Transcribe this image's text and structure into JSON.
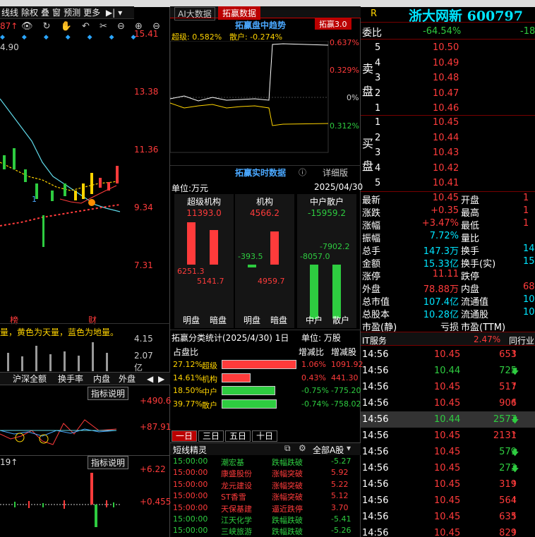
{
  "left": {
    "toolbar1": [
      "线线",
      "除权",
      "叠",
      "窗",
      "预测",
      "更多"
    ],
    "price_badge": "87↑",
    "price_value": "4.90",
    "axis_labels": [
      "15.41",
      "13.38",
      "11.36",
      "9.34",
      "7.31"
    ],
    "date_marks": [
      "榜",
      "财"
    ],
    "vol_legend": "量，黄色为天量，蓝色为地量。",
    "vol_axis": [
      "4.15",
      "2.07",
      "亿"
    ],
    "tabs2": [
      "沪深全额",
      "换手率",
      "内盘",
      "外盘"
    ],
    "ind_btn1": "指标说明",
    "ind_axis1": [
      "+490.6",
      "+87.91"
    ],
    "ind_val2": "19↑",
    "ind_btn2": "指标说明",
    "ind_axis2": [
      "+6.22",
      "+0.455"
    ]
  },
  "mid": {
    "tabs": [
      "AI大数据",
      "拓赢数据"
    ],
    "chart_title": "拓赢盘中趋势",
    "chart_badge": "拓赢3.0",
    "chart_legend_super": "超级: 0.582%",
    "chart_legend_retail": "散户: -0.274%",
    "chart_axis": [
      "0.637%",
      "0.329%",
      "0%",
      "0.312%"
    ],
    "realtime_title": "拓赢实时数据",
    "detail": "详细版",
    "unit": "单位:万元",
    "date": "2025/04/30",
    "cols": [
      {
        "name": "超级机构",
        "total": "11393.0",
        "v1": "6251.3",
        "v2": "5141.7",
        "l1": "明盘",
        "l2": "暗盘"
      },
      {
        "name": "机构",
        "total": "4566.2",
        "v1": "-393.5",
        "v2": "4959.7",
        "l1": "明盘",
        "l2": "暗盘"
      },
      {
        "name": "中户散户",
        "total": "-15959.2",
        "v1": "-8057.0",
        "v2": "-7902.2",
        "l1": "中户",
        "l2": "散户"
      }
    ],
    "cls_title": "拓赢分类统计(2025/4/30) 1日",
    "cls_unit": "单位: 万股",
    "cls_header": [
      "占盘比",
      "增减比",
      "增减股"
    ],
    "cls_rows": [
      {
        "pct": "27.12%",
        "name": "超级",
        "chg": "1.06%",
        "shares": "1091.92",
        "bar": 1.0,
        "color": "#ff3b3b"
      },
      {
        "pct": "14.61%",
        "name": "机构",
        "chg": "0.43%",
        "shares": "441.30",
        "bar": 0.39,
        "color": "#ff3b3b"
      },
      {
        "pct": "18.50%",
        "name": "中户",
        "chg": "-0.75%",
        "shares": "-775.20",
        "bar": 0.72,
        "color": "#2ecc40"
      },
      {
        "pct": "39.77%",
        "name": "散户",
        "chg": "-0.74%",
        "shares": "-758.02",
        "bar": 0.74,
        "color": "#2ecc40"
      }
    ],
    "period_tabs": [
      "一日",
      "三日",
      "五日",
      "十日"
    ],
    "dx_title": "短线精灵",
    "dx_filter": "全部A股",
    "dx_rows": [
      {
        "time": "15:00:00",
        "name": "潮宏基",
        "type": "跌幅跌破",
        "val": "-5.27"
      },
      {
        "time": "15:00:00",
        "name": "康盛股份",
        "type": "涨幅突破",
        "val": "5.92"
      },
      {
        "time": "15:00:00",
        "name": "龙元建设",
        "type": "涨幅突破",
        "val": "5.22"
      },
      {
        "time": "15:00:00",
        "name": "ST香雪",
        "type": "涨幅突破",
        "val": "5.12"
      },
      {
        "time": "15:00:00",
        "name": "天保基建",
        "type": "逼近跌停",
        "val": "3.70"
      },
      {
        "time": "15:00:00",
        "name": "江天化学",
        "type": "跌幅跌破",
        "val": "-5.41"
      },
      {
        "time": "15:00:00",
        "name": "三峡旅游",
        "type": "跌幅跌破",
        "val": "-5.26"
      }
    ]
  },
  "right": {
    "r": "R",
    "title": "浙大网新 600797",
    "wb_label": "委比",
    "wb_val": "-64.54%",
    "wb_val2": "-18",
    "sell_label": [
      "卖",
      "盘"
    ],
    "buy_label": [
      "买",
      "盘"
    ],
    "sells": [
      {
        "n": "5",
        "p": "10.50"
      },
      {
        "n": "4",
        "p": "10.49"
      },
      {
        "n": "3",
        "p": "10.48"
      },
      {
        "n": "2",
        "p": "10.47"
      },
      {
        "n": "1",
        "p": "10.46"
      }
    ],
    "buys": [
      {
        "n": "1",
        "p": "10.45"
      },
      {
        "n": "2",
        "p": "10.44"
      },
      {
        "n": "3",
        "p": "10.43"
      },
      {
        "n": "4",
        "p": "10.42"
      },
      {
        "n": "5",
        "p": "10.41"
      }
    ],
    "quote": [
      {
        "k": "最新",
        "v": "10.45",
        "k2": "开盘",
        "c": "red"
      },
      {
        "k": "涨跌",
        "v": "+0.35",
        "k2": "最高",
        "c": "red"
      },
      {
        "k": "涨幅",
        "v": "+3.47%",
        "k2": "最低",
        "c": "red"
      },
      {
        "k": "振幅",
        "v": "7.72%",
        "k2": "量比",
        "c": "cyan"
      },
      {
        "k": "总手",
        "v": "147.3万",
        "k2": "换手",
        "c": "cyan"
      },
      {
        "k": "金额",
        "v": "15.33亿",
        "k2": "换手(实)",
        "c": "cyan"
      },
      {
        "k": "涨停",
        "v": "11.11",
        "k2": "跌停",
        "c": "red"
      },
      {
        "k": "外盘",
        "v": "78.88万",
        "k2": "内盘",
        "c": "red"
      },
      {
        "k": "总市值",
        "v": "107.4亿",
        "k2": "流通值",
        "c": "cyan"
      },
      {
        "k": "总股本",
        "v": "10.28亿",
        "k2": "流通股",
        "c": "cyan"
      },
      {
        "k": "市盈(静)",
        "v": "亏损",
        "k2": "市盈(TTM)",
        "c": "wht"
      }
    ],
    "quote_right": [
      "1",
      "1",
      "1",
      "",
      "14",
      "15",
      "",
      "68.",
      "107",
      "10.",
      ""
    ],
    "it_label": "IT服务",
    "it_pct": "2.47%",
    "it_more": "同行业",
    "ticks": [
      {
        "t": "14:56",
        "p": "10.45",
        "v": "653",
        "d": "up"
      },
      {
        "t": "14:56",
        "p": "10.44",
        "v": "725",
        "d": "down"
      },
      {
        "t": "14:56",
        "p": "10.45",
        "v": "517",
        "d": "up"
      },
      {
        "t": "14:56",
        "p": "10.45",
        "v": "906",
        "d": "up"
      },
      {
        "t": "14:56",
        "p": "10.44",
        "v": "2577",
        "d": "down"
      },
      {
        "t": "14:56",
        "p": "10.45",
        "v": "2131",
        "d": "up"
      },
      {
        "t": "14:56",
        "p": "10.45",
        "v": "579",
        "d": "down"
      },
      {
        "t": "14:56",
        "p": "10.45",
        "v": "273",
        "d": "down"
      },
      {
        "t": "14:56",
        "p": "10.45",
        "v": "319",
        "d": "up"
      },
      {
        "t": "14:56",
        "p": "10.45",
        "v": "564",
        "d": "up"
      },
      {
        "t": "14:56",
        "p": "10.45",
        "v": "635",
        "d": "up"
      },
      {
        "t": "14:56",
        "p": "10.45",
        "v": "829",
        "d": "up"
      }
    ]
  }
}
